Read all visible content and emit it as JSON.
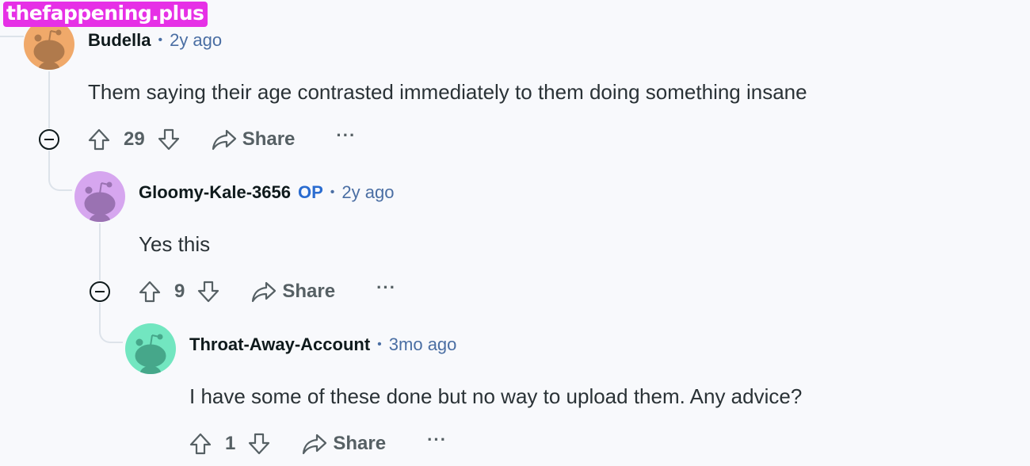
{
  "watermark": "thefappening.plus",
  "comments": [
    {
      "username": "Budella",
      "op": "",
      "time": "2y ago",
      "body": "Them saying their age contrasted immediately to them doing something insane",
      "score": "29",
      "share_label": "Share",
      "more_label": "···",
      "avatar_color": "#f0a96a",
      "avatar_figure_color": "#b07a4c"
    },
    {
      "username": "Gloomy-Kale-3656",
      "op": "OP",
      "time": "2y ago",
      "body": "Yes this",
      "score": "9",
      "share_label": "Share",
      "more_label": "···",
      "avatar_color": "#d6a6ef",
      "avatar_figure_color": "#9a72b2"
    },
    {
      "username": "Throat-Away-Account",
      "op": "",
      "time": "3mo ago",
      "body": "I have some of these done but no way to upload them. Any advice?",
      "score": "1",
      "share_label": "Share",
      "more_label": "···",
      "avatar_color": "#72e6c0",
      "avatar_figure_color": "#46a78a"
    }
  ],
  "colors": {
    "background": "#f8f9fc",
    "link_blue": "#4a6ea3",
    "op_blue": "#2a6cd0",
    "action_gray": "#566064",
    "watermark_bg": "#e630e6"
  },
  "icons": {
    "upvote": "arrow-up-icon",
    "downvote": "arrow-down-icon",
    "share": "share-arrow-icon",
    "collapse": "minus-circle-icon",
    "more": "ellipsis-icon"
  }
}
